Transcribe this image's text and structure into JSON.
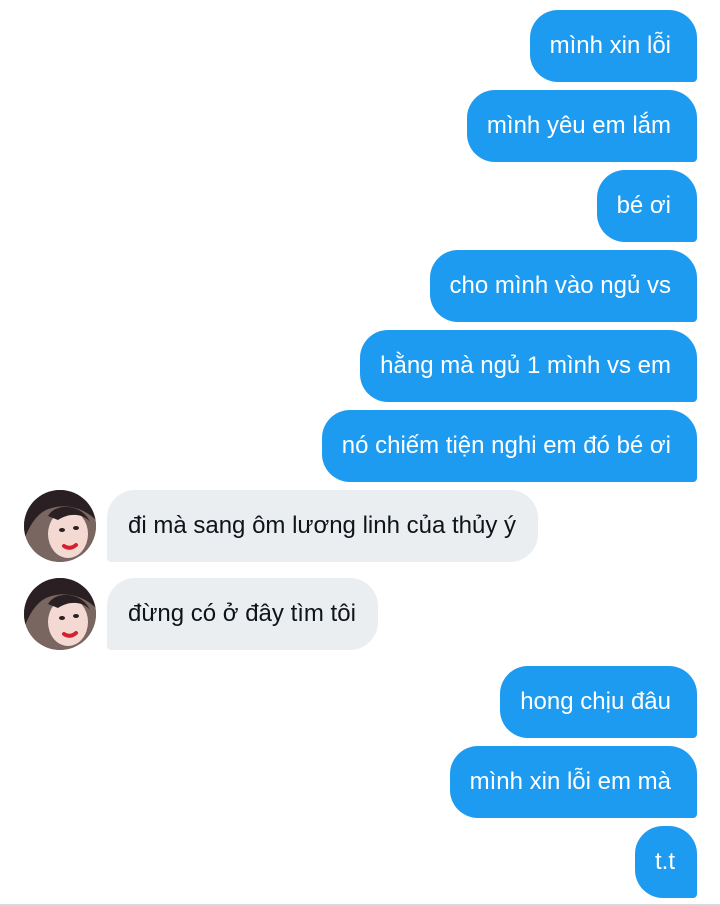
{
  "messages": [
    {
      "side": "out",
      "text": "mình xin lỗi"
    },
    {
      "side": "out",
      "text": "mình yêu em lắm"
    },
    {
      "side": "out",
      "text": "bé ơi"
    },
    {
      "side": "out",
      "text": "cho mình vào ngủ vs"
    },
    {
      "side": "out",
      "text": "hằng mà ngủ 1 mình vs em"
    },
    {
      "side": "out",
      "text": "nó chiếm tiện nghi em đó bé ơi"
    },
    {
      "side": "in",
      "text": "đi mà sang ôm lương linh của thủy ý"
    },
    {
      "side": "in",
      "text": "đừng có ở đây tìm tôi"
    },
    {
      "side": "out",
      "text": "hong chịu đâu"
    },
    {
      "side": "out",
      "text": "mình xin lỗi em mà"
    },
    {
      "side": "out",
      "text": "t.t"
    }
  ],
  "colors": {
    "outgoing_bubble": "#1d9bf0",
    "incoming_bubble": "#ebeef0",
    "outgoing_text": "#ffffff",
    "incoming_text": "#0f1419"
  }
}
